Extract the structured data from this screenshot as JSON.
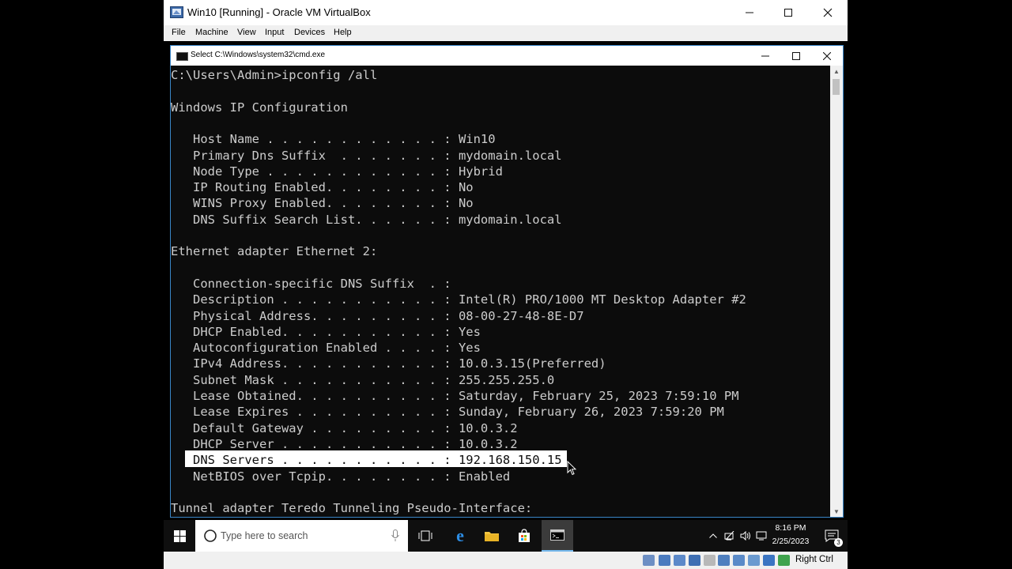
{
  "vbox": {
    "title": "Win10 [Running] - Oracle VM VirtualBox",
    "menu": [
      "File",
      "Machine",
      "View",
      "Input",
      "Devices",
      "Help"
    ],
    "status_right": "Right Ctrl"
  },
  "cmd": {
    "title": "Select C:\\Windows\\system32\\cmd.exe",
    "lines": [
      "C:\\Users\\Admin>ipconfig /all",
      "",
      "Windows IP Configuration",
      "",
      "   Host Name . . . . . . . . . . . . : Win10",
      "   Primary Dns Suffix  . . . . . . . : mydomain.local",
      "   Node Type . . . . . . . . . . . . : Hybrid",
      "   IP Routing Enabled. . . . . . . . : No",
      "   WINS Proxy Enabled. . . . . . . . : No",
      "   DNS Suffix Search List. . . . . . : mydomain.local",
      "",
      "Ethernet adapter Ethernet 2:",
      "",
      "   Connection-specific DNS Suffix  . :",
      "   Description . . . . . . . . . . . : Intel(R) PRO/1000 MT Desktop Adapter #2",
      "   Physical Address. . . . . . . . . : 08-00-27-48-8E-D7",
      "   DHCP Enabled. . . . . . . . . . . : Yes",
      "   Autoconfiguration Enabled . . . . : Yes",
      "   IPv4 Address. . . . . . . . . . . : 10.0.3.15(Preferred)",
      "   Subnet Mask . . . . . . . . . . . : 255.255.255.0",
      "   Lease Obtained. . . . . . . . . . : Saturday, February 25, 2023 7:59:10 PM",
      "   Lease Expires . . . . . . . . . . : Sunday, February 26, 2023 7:59:20 PM",
      "   Default Gateway . . . . . . . . . : 10.0.3.2",
      "   DHCP Server . . . . . . . . . . . : 10.0.3.2",
      "   DNS Servers . . . . . . . . . . . : 192.168.150.15",
      "   NetBIOS over Tcpip. . . . . . . . : Enabled",
      "",
      "Tunnel adapter Teredo Tunneling Pseudo-Interface:"
    ],
    "selected_line_index": 24
  },
  "taskbar": {
    "search_placeholder": "Type here to search",
    "time": "8:16 PM",
    "date": "2/25/2023",
    "notification_count": "3"
  }
}
